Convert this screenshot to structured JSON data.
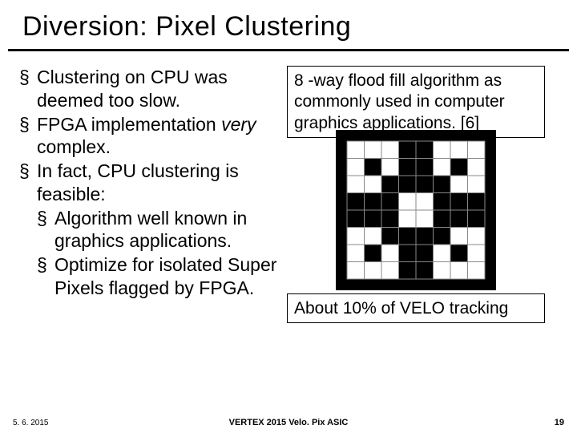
{
  "title": "Diversion: Pixel Clustering",
  "bullets": {
    "b1": "Clustering on CPU was deemed too slow.",
    "b2_pre": "FPGA implementation ",
    "b2_ital": "very",
    "b2_post": "  complex.",
    "b3": "In fact, CPU clustering is feasible:",
    "s1": "Algorithm well known in graphics applications.",
    "s2": "Optimize for isolated Super Pixels flagged by FPGA."
  },
  "box_top": "8 -way flood fill algorithm as\ncommonly used in computer\ngraphics applications. [6]",
  "box_bottom": "About 10% of VELO tracking",
  "footer": {
    "date": "5. 6. 2015",
    "mid": "VERTEX 2015 Velo. Pix ASIC",
    "page": "19"
  },
  "grid": {
    "size": 8,
    "black": [
      [
        0,
        3
      ],
      [
        0,
        4
      ],
      [
        1,
        1
      ],
      [
        1,
        3
      ],
      [
        1,
        4
      ],
      [
        1,
        6
      ],
      [
        2,
        2
      ],
      [
        2,
        3
      ],
      [
        2,
        4
      ],
      [
        2,
        5
      ],
      [
        3,
        0
      ],
      [
        3,
        1
      ],
      [
        3,
        2
      ],
      [
        3,
        5
      ],
      [
        3,
        6
      ],
      [
        3,
        7
      ],
      [
        4,
        0
      ],
      [
        4,
        1
      ],
      [
        4,
        2
      ],
      [
        4,
        5
      ],
      [
        4,
        6
      ],
      [
        4,
        7
      ],
      [
        5,
        2
      ],
      [
        5,
        3
      ],
      [
        5,
        4
      ],
      [
        5,
        5
      ],
      [
        6,
        1
      ],
      [
        6,
        3
      ],
      [
        6,
        4
      ],
      [
        6,
        6
      ],
      [
        7,
        3
      ],
      [
        7,
        4
      ]
    ]
  }
}
